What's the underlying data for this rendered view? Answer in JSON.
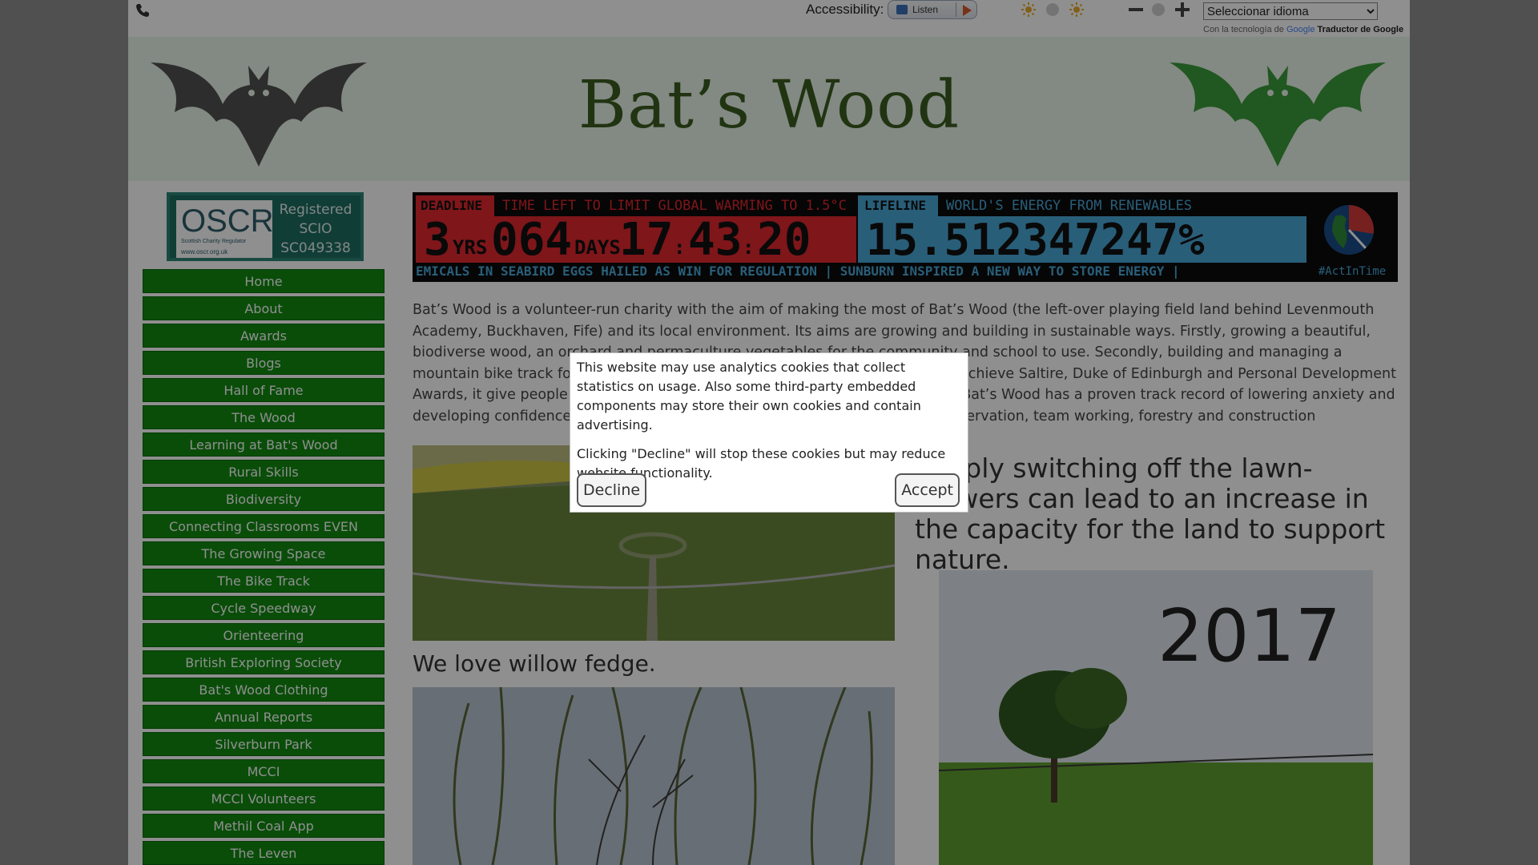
{
  "topbar": {
    "accessibility_label": "Accessibility:",
    "listen_label": "Listen",
    "language_select_value": "Seleccionar idioma",
    "powered_by_prefix": "Con la tecnología de",
    "powered_by_google": "Google",
    "powered_by_translate": "Traductor de Google"
  },
  "header": {
    "site_title": "Bat’s Wood"
  },
  "oscr": {
    "logo_text": "OSCR",
    "logo_subtitle": "Scottish Charity Regulator",
    "logo_url": "www.oscr.org.uk",
    "line1": "Registered",
    "line2": "SCIO",
    "line3": "SC049338"
  },
  "nav": {
    "items": [
      "Home",
      "About",
      "Awards",
      "Blogs",
      "Hall of Fame",
      "The Wood",
      "Learning at Bat's Wood",
      "Rural Skills",
      "Biodiversity",
      "Connecting Classrooms EVEN",
      "The Growing Space",
      "The Bike Track",
      "Cycle Speedway",
      "Orienteering",
      "British Exploring Society",
      "Bat's Wood Clothing",
      "Annual Reports",
      "Silverburn Park",
      "MCCI",
      "MCCI Volunteers",
      "Methil Coal App",
      "The Leven"
    ]
  },
  "climate_clock": {
    "deadline_tag": "DEADLINE",
    "deadline_text": "TIME LEFT TO LIMIT GLOBAL WARMING TO 1.5°C",
    "years": "3",
    "years_unit": "YRS",
    "days": "064",
    "days_unit": "DAYS",
    "hours": "17",
    "minutes": "43",
    "seconds": "20",
    "colon": ":",
    "lifeline_tag": "LIFELINE",
    "lifeline_text": "WORLD'S ENERGY FROM RENEWABLES",
    "lifeline_value": "15.512347247%",
    "ticker": "EMICALS IN SEABIRD EGGS HAILED AS WIN FOR REGULATION | SUNBURN INSPIRED A NEW WAY TO STORE ENERGY |",
    "hashtag": "#ActInTime"
  },
  "content": {
    "intro": "Bat’s Wood is a volunteer-run charity with the aim of making the most of Bat’s Wood (the left-over playing field land behind Levenmouth Academy, Buckhaven, Fife) and its local environment. Its aims are growing and building in sustainable ways. Firstly, growing a beautiful, biodiverse wood, an orchard and permaculture vegetables for the community and school to use. Secondly, building and managing a mountain bike track for all ages and abilities. Bat’s Wood helps young people achieve Saltire, Duke of Edinburgh and Personal Development Awards, it give people a real-world project to make their own. Volunteering at Bat’s Wood has a proven track record of lowering anxiety and developing confidence, as well as the basic practical skills of horticulture, conservation, team working, forestry and construction",
    "willow_caption": "We love willow fedge.",
    "quote": "Simply switching off the lawn-mowers can lead to an increase in the capacity for the land to support nature.",
    "year_label": "2017"
  },
  "cookie_dialog": {
    "text1": "This website may use analytics cookies that collect statistics on usage. Also some third-party embedded components may store their own cookies and contain advertising.",
    "text2": "Clicking \"Decline\" will stop these cookies but may reduce website functionality.",
    "decline_label": "Decline",
    "accept_label": "Accept"
  },
  "colors": {
    "nav_green": "#108a10",
    "deadline_red": "#e0282f",
    "lifeline_blue": "#4aa8d8",
    "title_green": "#3b5d21"
  }
}
